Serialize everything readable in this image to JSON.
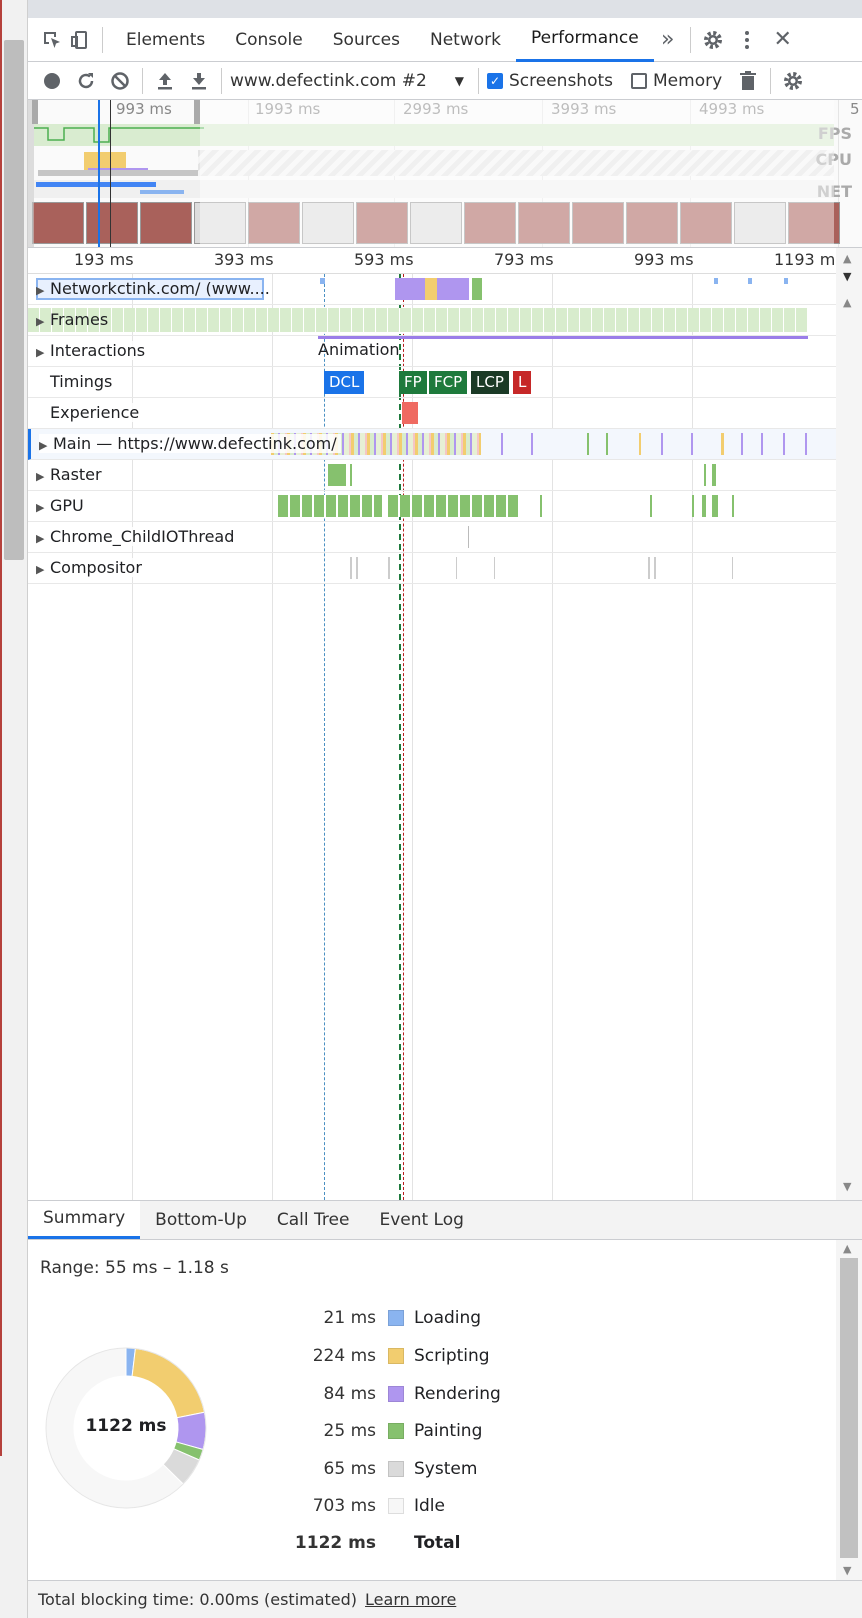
{
  "devtools": {
    "tabs": [
      "Elements",
      "Console",
      "Sources",
      "Network",
      "Performance"
    ],
    "active_tab": "Performance"
  },
  "toolbar": {
    "profile_select": "www.defectink.com #2",
    "screenshots_label": "Screenshots",
    "screenshots_checked": true,
    "memory_label": "Memory",
    "memory_checked": false
  },
  "overview": {
    "ticks": [
      "993 ms",
      "1993 ms",
      "2993 ms",
      "3993 ms",
      "4993 ms",
      "5"
    ],
    "labels": [
      "FPS",
      "CPU",
      "NET"
    ]
  },
  "ruler": {
    "ticks": [
      "193 ms",
      "393 ms",
      "593 ms",
      "793 ms",
      "993 ms",
      "1193 m"
    ]
  },
  "tracks": {
    "network": "Network",
    "network_url": "ctink.com/ (www....",
    "frames": "Frames",
    "interactions": "Interactions",
    "interactions_animation": "Animation",
    "timings": "Timings",
    "experience": "Experience",
    "main": "Main — https://www.defectink.com/",
    "raster": "Raster",
    "gpu": "GPU",
    "chrome_child": "Chrome_ChildIOThread",
    "compositor": "Compositor"
  },
  "timing_markers": [
    "DCL",
    "FP",
    "FCP",
    "LCP",
    "L"
  ],
  "bottom_tabs": [
    "Summary",
    "Bottom-Up",
    "Call Tree",
    "Event Log"
  ],
  "summary": {
    "range": "Range: 55 ms – 1.18 s",
    "total_center": "1122 ms",
    "rows": [
      {
        "value": "21 ms",
        "label": "Loading",
        "color": "#8ab4f0"
      },
      {
        "value": "224 ms",
        "label": "Scripting",
        "color": "#f2cd6f"
      },
      {
        "value": "84 ms",
        "label": "Rendering",
        "color": "#af96ef"
      },
      {
        "value": "25 ms",
        "label": "Painting",
        "color": "#86c16e"
      },
      {
        "value": "65 ms",
        "label": "System",
        "color": "#dadada"
      },
      {
        "value": "703 ms",
        "label": "Idle",
        "color": "#f7f7f7"
      }
    ],
    "total_value": "1122 ms",
    "total_label": "Total"
  },
  "footer": {
    "text": "Total blocking time: 0.00ms (estimated)",
    "link": "Learn more"
  }
}
